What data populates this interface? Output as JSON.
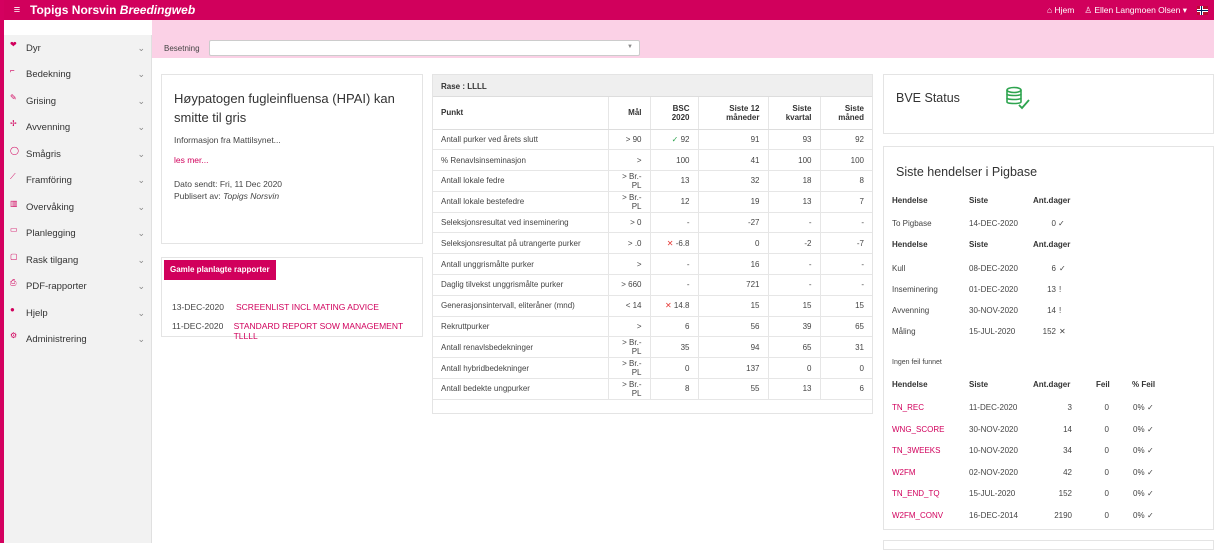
{
  "app": {
    "title_main": "Topigs Norsvin",
    "title_italic": "Breedingweb"
  },
  "topbar": {
    "home": "⌂ Hjem",
    "user": "♙ Ellen Langmoen Olsen ▾",
    "menu_icon": "≡"
  },
  "sidebar": {
    "items": [
      {
        "label": "Dyr",
        "icon": "pig-icon"
      },
      {
        "label": "Bedekning",
        "icon": "mating-icon"
      },
      {
        "label": "Grising",
        "icon": "farrowing-icon"
      },
      {
        "label": "Avvenning",
        "icon": "weaning-icon"
      },
      {
        "label": "Smågris",
        "icon": "piglet-icon"
      },
      {
        "label": "Framföring",
        "icon": "growth-icon"
      },
      {
        "label": "Overvåking",
        "icon": "monitor-icon"
      },
      {
        "label": "Planlegging",
        "icon": "calendar-icon"
      },
      {
        "label": "Rask tilgang",
        "icon": "quick-access-icon"
      },
      {
        "label": "PDF-rapporter",
        "icon": "pdf-icon"
      },
      {
        "label": "Hjelp",
        "icon": "help-icon"
      },
      {
        "label": "Administrering",
        "icon": "admin-icon"
      }
    ]
  },
  "filter": {
    "label": "Besetning",
    "value": ""
  },
  "news": {
    "title": "Høypatogen fugleinfluensa (HPAI) kan smitte til gris",
    "summary": "Informasjon fra Mattilsynet...",
    "more": "les mer...",
    "date": "Dato sendt: Fri, 11 Dec 2020",
    "published_by_label": "Publisert av: ",
    "published_by": "Topigs Norsvin"
  },
  "reports": {
    "button": "Gamle planlagte rapporter",
    "rows": [
      {
        "date": "13-DEC-2020",
        "name": "SCREENLIST INCL MATING ADVICE"
      },
      {
        "date": "11-DEC-2020",
        "name": "STANDARD REPORT SOW MANAGEMENT TLLLL"
      }
    ]
  },
  "kpi": {
    "header": "Rase : LLLL",
    "columns": [
      "Punkt",
      "Mål",
      "BSC 2020",
      "Siste 12 måneder",
      "Siste kvartal",
      "Siste måned"
    ],
    "rows": [
      [
        "Antall purker ved årets slutt",
        "> 90",
        "✓ 92",
        "91",
        "93",
        "92"
      ],
      [
        "% Renavlsinseminasjon",
        ">",
        "100",
        "41",
        "100",
        "100"
      ],
      [
        "Antall lokale fedre",
        "> Br.-PL",
        "13",
        "32",
        "18",
        "8"
      ],
      [
        "Antall lokale bestefedre",
        "> Br.-PL",
        "12",
        "19",
        "13",
        "7"
      ],
      [
        "Seleksjonsresultat ved inseminering",
        "> 0",
        "-",
        "-27",
        "-",
        "-"
      ],
      [
        "Seleksjonsresultat på utrangerte purker",
        "> .0",
        "✕ -6.8",
        "0",
        "-2",
        "-7"
      ],
      [
        "Antall unggrismålte purker",
        ">",
        "-",
        "16",
        "-",
        "-"
      ],
      [
        "Daglig tilvekst unggrismålte purker",
        "> 660",
        "-",
        "721",
        "-",
        "-"
      ],
      [
        "Generasjonsintervall, eliteråner (mnd)",
        "< 14",
        "✕ 14.8",
        "15",
        "15",
        "15"
      ],
      [
        "Rekruttpurker",
        ">",
        "6",
        "56",
        "39",
        "65"
      ],
      [
        "Antall renavlsbedekninger",
        "> Br.-PL",
        "35",
        "94",
        "65",
        "31"
      ],
      [
        "Antall hybridbedekninger",
        "> Br.-PL",
        "0",
        "137",
        "0",
        "0"
      ],
      [
        "Antall bedekte ungpurker",
        "> Br.-PL",
        "8",
        "55",
        "13",
        "6"
      ]
    ]
  },
  "bve": {
    "title": "BVE Status"
  },
  "events": {
    "title": "Siste hendelser i Pigbase",
    "h1": [
      "Hendelse",
      "Siste",
      "Ant.dager"
    ],
    "g1": [
      {
        "name": "To Pigbase",
        "date": "14-DEC-2020",
        "days": "0",
        "mark": "✓"
      }
    ],
    "h2": [
      "Hendelse",
      "Siste",
      "Ant.dager"
    ],
    "g2": [
      {
        "name": "Kull",
        "date": "08-DEC-2020",
        "days": "6",
        "mark": "✓"
      },
      {
        "name": "Inseminering",
        "date": "01-DEC-2020",
        "days": "13",
        "mark": "!"
      },
      {
        "name": "Avvenning",
        "date": "30-NOV-2020",
        "days": "14",
        "mark": "!"
      },
      {
        "name": "Måling",
        "date": "15-JUL-2020",
        "days": "152",
        "mark": "✕"
      }
    ],
    "no_errors": "Ingen feil funnet",
    "h3": [
      "Hendelse",
      "Siste",
      "Ant.dager",
      "Feil",
      "% Feil"
    ],
    "g3": [
      {
        "name": "TN_REC",
        "date": "11-DEC-2020",
        "days": "3",
        "err": "0",
        "pct": "0%"
      },
      {
        "name": "WNG_SCORE",
        "date": "30-NOV-2020",
        "days": "14",
        "err": "0",
        "pct": "0%"
      },
      {
        "name": "TN_3WEEKS",
        "date": "10-NOV-2020",
        "days": "34",
        "err": "0",
        "pct": "0%"
      },
      {
        "name": "W2FM",
        "date": "02-NOV-2020",
        "days": "42",
        "err": "0",
        "pct": "0%"
      },
      {
        "name": "TN_END_TQ",
        "date": "15-JUL-2020",
        "days": "152",
        "err": "0",
        "pct": "0%"
      },
      {
        "name": "W2FM_CONV",
        "date": "16-DEC-2014",
        "days": "2190",
        "err": "0",
        "pct": "0%"
      }
    ]
  }
}
